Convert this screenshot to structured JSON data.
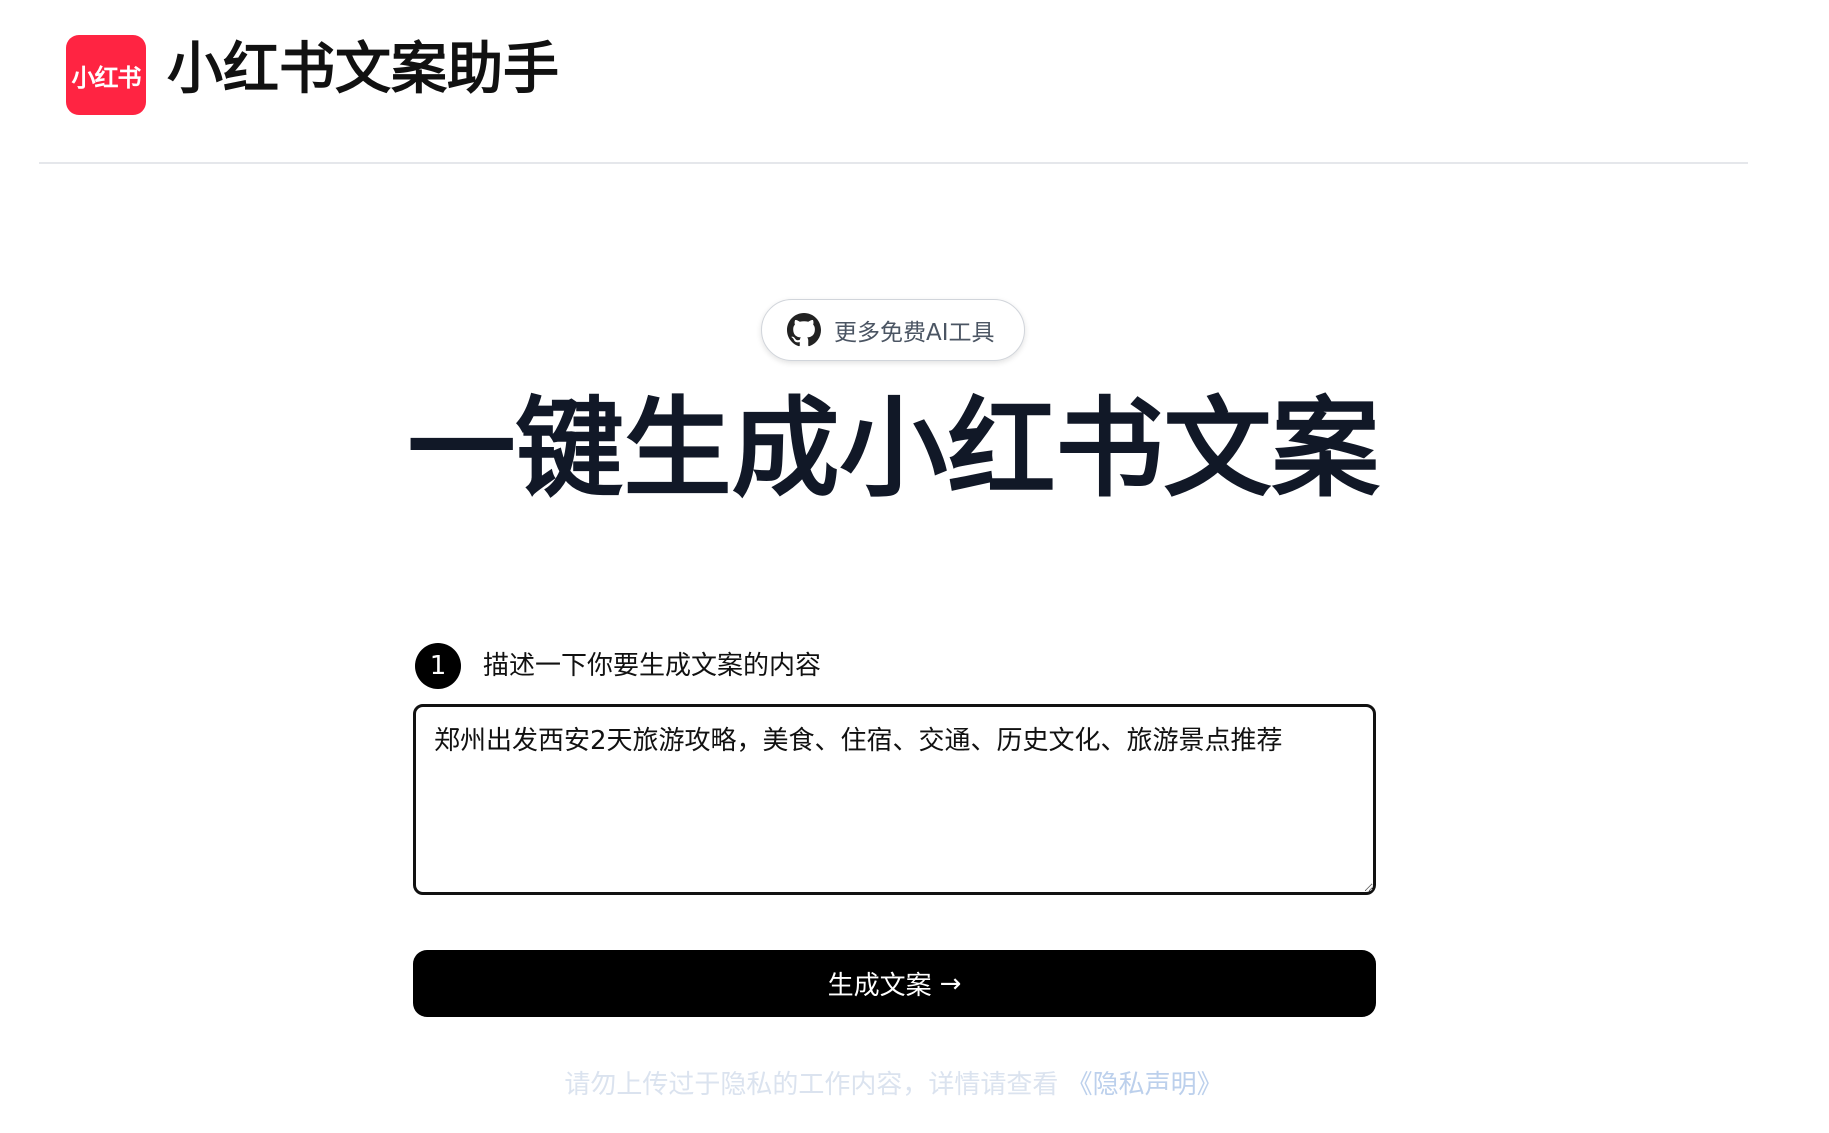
{
  "header": {
    "logo_text": "小红书",
    "title": "小红书文案助手"
  },
  "github_pill": {
    "label": "更多免费AI工具",
    "icon": "github-icon"
  },
  "hero": {
    "title": "一键生成小红书文案"
  },
  "step1": {
    "number": "1",
    "label": "描述一下你要生成文案的内容"
  },
  "input": {
    "value": "郑州出发西安2天旅游攻略，美食、住宿、交通、历史文化、旅游景点推荐"
  },
  "generate_button": {
    "label": "生成文案",
    "arrow": "→"
  },
  "privacy": {
    "text": "请勿上传过于隐私的工作内容，详情请查看",
    "link": "《隐私声明》"
  },
  "colors": {
    "brand": "#ff2442",
    "button": "#000000",
    "hero_text": "#111827",
    "privacy_text": "#dbe3ef",
    "privacy_link": "#bcd0ec"
  }
}
